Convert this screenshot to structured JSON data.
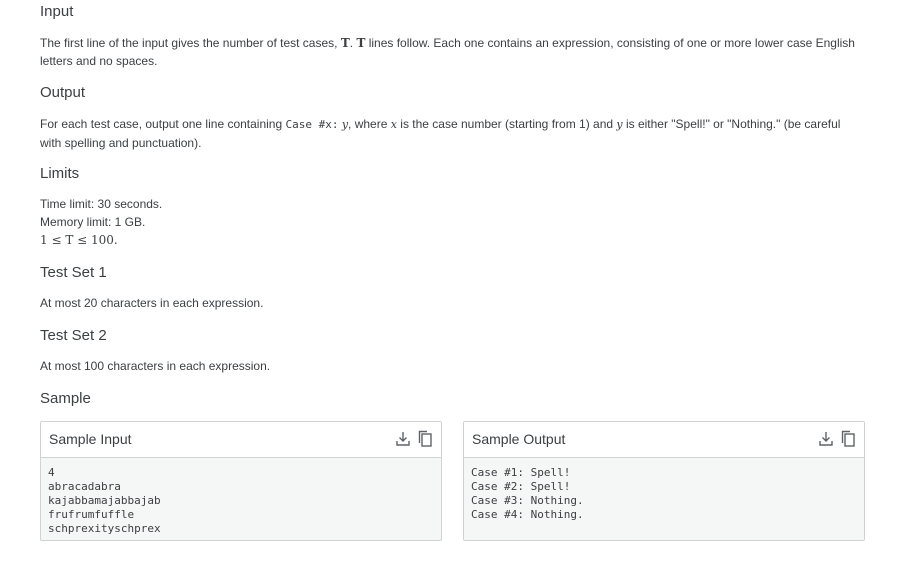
{
  "sections": {
    "input": {
      "heading": "Input",
      "text_a": "The first line of the input gives the number of test cases, ",
      "var_t": "T",
      "text_b": ". ",
      "text_c": " lines follow. Each one contains an expression, consisting of one or more lower case English letters and no spaces."
    },
    "output": {
      "heading": "Output",
      "text_a": "For each test case, output one line containing ",
      "code": "Case #x:",
      "var_y": "y",
      "text_b": ", where ",
      "var_x": "x",
      "text_c": " is the case number (starting from 1) and ",
      "text_d": " is either \"Spell!\" or \"Nothing.\" (be careful with spelling and punctuation)."
    },
    "limits": {
      "heading": "Limits",
      "time": "Time limit: 30 seconds.",
      "memory": "Memory limit: 1 GB.",
      "constraint": "1 ≤ T ≤ 100."
    },
    "test_set_1": {
      "heading": "Test Set 1",
      "text": "At most 20 characters in each expression."
    },
    "test_set_2": {
      "heading": "Test Set 2",
      "text": "At most 100 characters in each expression."
    },
    "sample": {
      "heading": "Sample",
      "input_title": "Sample Input",
      "input_text": "4\nabracadabra\nkajabbamajabbajab\nfrufrumfuffle\nschprexityschprex",
      "output_title": "Sample Output",
      "output_text": "Case #1: Spell!\nCase #2: Spell!\nCase #3: Nothing.\nCase #4: Nothing."
    }
  },
  "icons": {
    "download": "download-icon",
    "copy": "copy-icon"
  }
}
